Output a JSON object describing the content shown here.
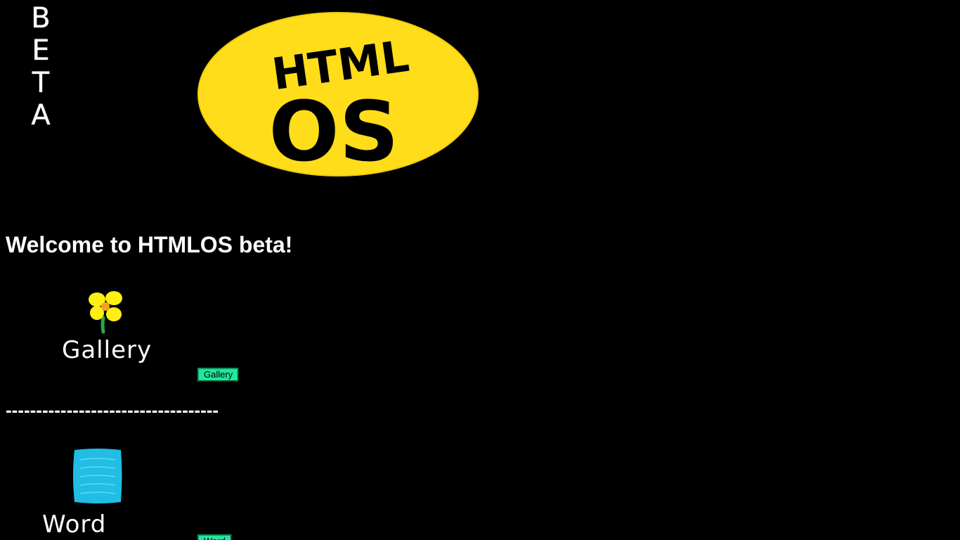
{
  "beta_logo": {
    "letters": [
      "B",
      "E",
      "T",
      "A"
    ]
  },
  "logo": {
    "line1": "HTML",
    "line2": "OS",
    "color": "#FFDD1B"
  },
  "welcome": {
    "heading": "Welcome to HTMLOS beta!"
  },
  "apps": [
    {
      "art_label": "Gallery",
      "icon": "flower-icon",
      "button_label": "Gallery"
    },
    {
      "art_label": "Word",
      "icon": "document-icon",
      "button_label": "Word"
    }
  ],
  "separator": {
    "text": "-----------------------------------"
  },
  "colors": {
    "background": "#000000",
    "button": "#1FE89A",
    "text": "#FFFFFF"
  }
}
